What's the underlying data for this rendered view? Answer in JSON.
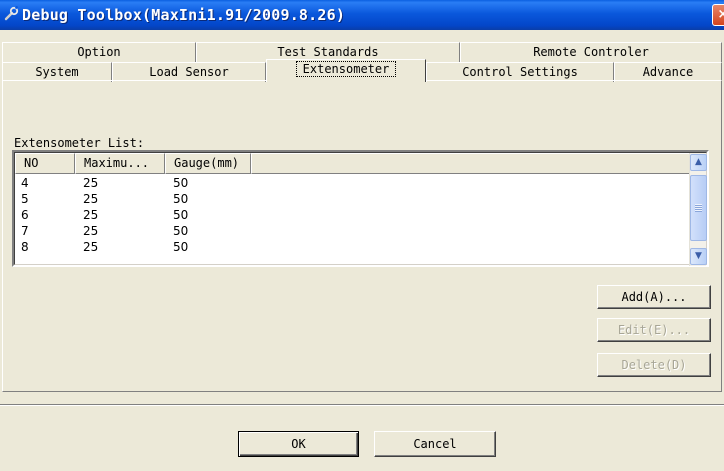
{
  "window": {
    "title": "Debug Toolbox(MaxIni1.91/2009.8.26)",
    "close_glyph": "×"
  },
  "tabs_row1": [
    {
      "label": "Option"
    },
    {
      "label": "Test Standards"
    },
    {
      "label": "Remote Controler"
    }
  ],
  "tabs_row2": [
    {
      "label": "System"
    },
    {
      "label": "Load Sensor"
    },
    {
      "label": "Extensometer"
    },
    {
      "label": "Control Settings"
    },
    {
      "label": "Advance"
    }
  ],
  "active_tab": "Extensometer",
  "list": {
    "label": "Extensometer List:",
    "columns": [
      "NO",
      "Maximu...",
      "Gauge(mm)"
    ],
    "rows": [
      {
        "no": "4",
        "max": "25",
        "gauge": "50"
      },
      {
        "no": "5",
        "max": "25",
        "gauge": "50"
      },
      {
        "no": "6",
        "max": "25",
        "gauge": "50"
      },
      {
        "no": "7",
        "max": "25",
        "gauge": "50"
      },
      {
        "no": "8",
        "max": "25",
        "gauge": "50"
      }
    ],
    "scroll_up_glyph": "▲",
    "scroll_down_glyph": "▼"
  },
  "buttons": {
    "add": "Add(A)...",
    "edit": "Edit(E)...",
    "delete": "Delete(D)",
    "ok": "OK",
    "cancel": "Cancel"
  },
  "icons": {
    "title_icon": "wrench-icon"
  }
}
